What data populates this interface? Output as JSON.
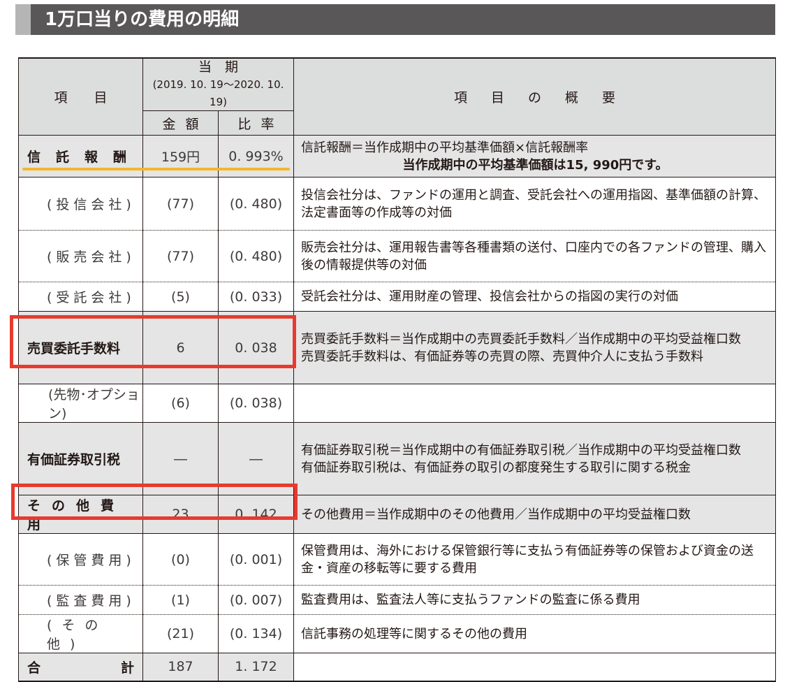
{
  "title": "1万口当りの費用の明細",
  "header": {
    "item": "項目",
    "period": "当　期",
    "period_range": "(2019. 10. 19～2020. 10. 19)",
    "amount": "金額",
    "ratio": "比率",
    "summary": "項目の概要"
  },
  "rows": {
    "trust_fee": {
      "item": "信託報酬",
      "amount": "159円",
      "ratio": "0. 993%",
      "desc1": "信託報酬＝当作成期中の平均基準価額×信託報酬率",
      "desc2": "当作成期中の平均基準価額は15, 990円です。"
    },
    "investment_co": {
      "item": "(投信会社)",
      "amount": "(77)",
      "ratio": "(0. 480)",
      "desc": "投信会社分は、ファンドの運用と調査、受託会社への運用指図、基準価額の計算、法定書面等の作成等の対価"
    },
    "sales_co": {
      "item": "(販売会社)",
      "amount": "(77)",
      "ratio": "(0. 480)",
      "desc": "販売会社分は、運用報告書等各種書類の送付、口座内での各ファンドの管理、購入後の情報提供等の対価"
    },
    "trustee_co": {
      "item": "(受託会社)",
      "amount": "(5)",
      "ratio": "(0. 033)",
      "desc": "受託会社分は、運用財産の管理、投信会社からの指図の実行の対価"
    },
    "brokerage": {
      "item": "売買委託手数料",
      "amount": "6",
      "ratio": "0. 038",
      "desc1": "売買委託手数料＝当作成期中の売買委託手数料／当作成期中の平均受益権口数",
      "desc2": "売買委託手数料は、有価証券等の売買の際、売買仲介人に支払う手数料"
    },
    "futures": {
      "item": "(先物･オプション)",
      "amount": "(6)",
      "ratio": "(0. 038)",
      "desc": ""
    },
    "securities_tax": {
      "item": "有価証券取引税",
      "amount": "―",
      "ratio": "―",
      "desc1": "有価証券取引税＝当作成期中の有価証券取引税／当作成期中の平均受益権口数",
      "desc2": "有価証券取引税は、有価証券の取引の都度発生する取引に関する税金"
    },
    "other_expenses": {
      "item": "その他費用",
      "amount": "23",
      "ratio": "0. 142",
      "desc": "その他費用＝当作成期中のその他費用／当作成期中の平均受益権口数"
    },
    "custody": {
      "item": "(保管費用)",
      "amount": "(0)",
      "ratio": "(0. 001)",
      "desc": "保管費用は、海外における保管銀行等に支払う有価証券等の保管および資金の送金・資産の移転等に要する費用"
    },
    "audit": {
      "item": "(監査費用)",
      "amount": "(1)",
      "ratio": "(0. 007)",
      "desc": "監査費用は、監査法人等に支払うファンドの監査に係る費用"
    },
    "others": {
      "item": "(その他)",
      "amount": "(21)",
      "ratio": "(0. 134)",
      "desc": "信託事務の処理等に関するその他の費用"
    },
    "total": {
      "item_left": "合",
      "item_right": "計",
      "amount": "187",
      "ratio": "1. 172",
      "desc": ""
    }
  },
  "colors": {
    "title_bar": "#595757",
    "header_bg": "#dcdddd",
    "highlight_underline": "#f0b830",
    "highlight_box": "#e63b2e"
  }
}
